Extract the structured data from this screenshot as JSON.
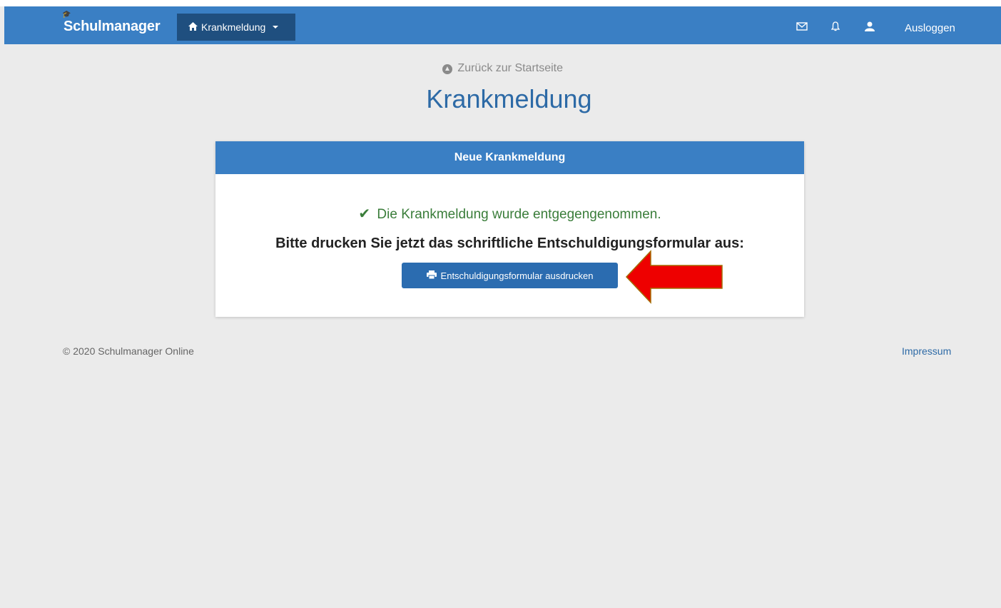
{
  "navbar": {
    "brand": "Schulmanager",
    "menu_label": "Krankmeldung",
    "logout_label": "Ausloggen"
  },
  "page": {
    "back_link": "Zurück zur Startseite",
    "title": "Krankmeldung"
  },
  "panel": {
    "header": "Neue Krankmeldung",
    "success_message": "Die Krankmeldung wurde entgegengenommen.",
    "instruction": "Bitte drucken Sie jetzt das schriftliche Entschuldigungsformular aus:",
    "print_button": "Entschuldigungsformular ausdrucken"
  },
  "footer": {
    "copyright": "© 2020 Schulmanager Online",
    "impressum": "Impressum"
  },
  "colors": {
    "navbar": "#3a7fc4",
    "nav_dropdown": "#1f4f7f",
    "title": "#2d6aa6",
    "success": "#3a7d3a",
    "button": "#2b6cb0",
    "arrow": "#ee0000"
  },
  "icons": [
    "graduation-cap-icon",
    "home-icon",
    "caret-down-icon",
    "envelope-icon",
    "bell-icon",
    "user-icon",
    "arrow-up-circle-icon",
    "checkmark-icon",
    "printer-icon",
    "red-arrow-icon"
  ]
}
